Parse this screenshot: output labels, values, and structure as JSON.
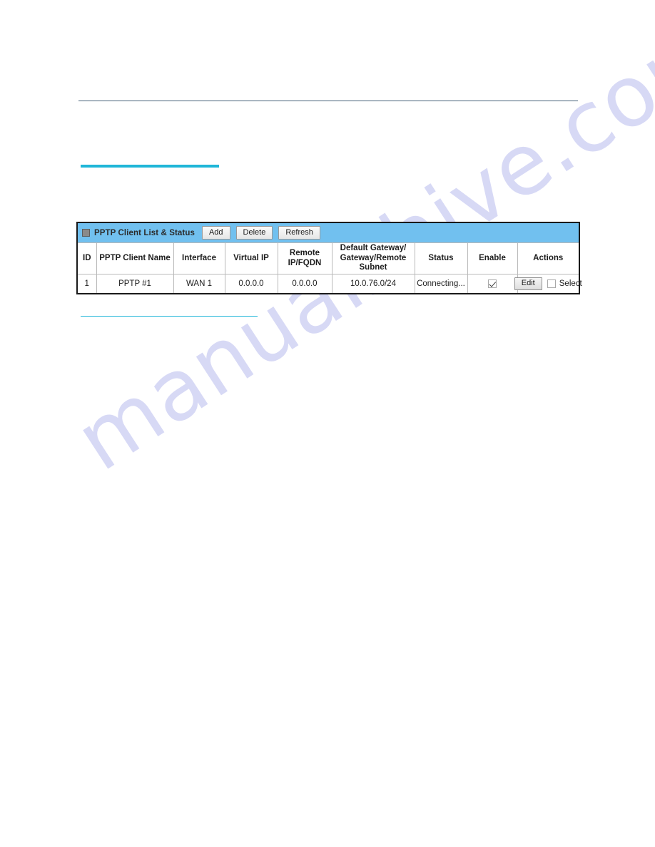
{
  "page": {
    "watermark": "manualshive.com",
    "rules": {
      "top_rule_color": "#47627a",
      "accent_color": "#1fb6d8"
    }
  },
  "panel": {
    "collapse_icon": "collapse-square-icon",
    "title": "PPTP Client List & Status",
    "title_bar_color": "#71c0ef",
    "toolbar": [
      {
        "name": "add-button",
        "label": "Add"
      },
      {
        "name": "delete-button",
        "label": "Delete"
      },
      {
        "name": "refresh-button",
        "label": "Refresh"
      }
    ],
    "table": {
      "headers": [
        "ID",
        "PPTP Client Name",
        "Interface",
        "Virtual IP",
        "Remote IP/FQDN",
        "Default Gateway/ Gateway/Remote Subnet",
        "Status",
        "Enable",
        "Actions"
      ],
      "headers_multiline": {
        "remote": [
          "Remote",
          "IP/FQDN"
        ],
        "gateway": [
          "Default Gateway/",
          "Gateway/Remote",
          "Subnet"
        ]
      },
      "rows": [
        {
          "id": "1",
          "client_name": "PPTP #1",
          "interface": "WAN 1",
          "virtual_ip": "0.0.0.0",
          "remote_ip_fqdn": "0.0.0.0",
          "default_gateway": "10.0.76.0/24",
          "status": "Connecting...",
          "enable_checked": true,
          "edit_label": "Edit",
          "select_label": "Select",
          "select_checked": false
        }
      ]
    }
  }
}
